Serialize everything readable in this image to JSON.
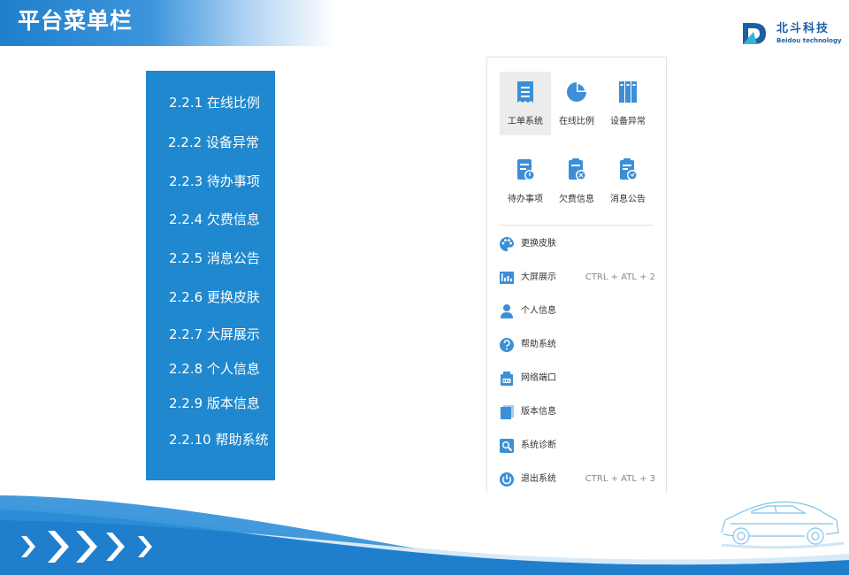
{
  "header": {
    "title": "平台菜单栏"
  },
  "logo": {
    "name": "北斗科技",
    "sub": "Beidou technology"
  },
  "toc": {
    "items": [
      "2.2.1 在线比例",
      "2.2.2 设备异常",
      "2.2.3 待办事项",
      "2.2.4 欠费信息",
      "2.2.5 消息公告",
      "2.2.6 更换皮肤",
      "2.2.7 大屏展示",
      "2.2.8 个人信息",
      "2.2.9 版本信息",
      "2.2.10 帮助系统"
    ]
  },
  "menu": {
    "grid": [
      {
        "label": "工单系统",
        "icon": "work-order-icon"
      },
      {
        "label": "在线比例",
        "icon": "pie-chart-icon"
      },
      {
        "label": "设备异常",
        "icon": "device-alert-icon"
      },
      {
        "label": "待办事项",
        "icon": "todo-icon"
      },
      {
        "label": "欠费信息",
        "icon": "arrears-icon"
      },
      {
        "label": "消息公告",
        "icon": "notice-icon"
      }
    ],
    "list": [
      {
        "label": "更换皮肤",
        "icon": "palette-icon",
        "shortcut": ""
      },
      {
        "label": "大屏展示",
        "icon": "monitor-icon",
        "shortcut": "CTRL + ATL + 2"
      },
      {
        "label": "个人信息",
        "icon": "user-icon",
        "shortcut": ""
      },
      {
        "label": "帮助系统",
        "icon": "help-icon",
        "shortcut": ""
      },
      {
        "label": "网络端口",
        "icon": "network-port-icon",
        "shortcut": ""
      },
      {
        "label": "版本信息",
        "icon": "version-icon",
        "shortcut": ""
      },
      {
        "label": "系统诊断",
        "icon": "diagnosis-icon",
        "shortcut": ""
      },
      {
        "label": "退出系统",
        "icon": "power-icon",
        "shortcut": "CTRL + ATL + 3"
      }
    ]
  },
  "colors": {
    "brand_blue": "#1f88cf",
    "icon_blue": "#3c8fd6",
    "logo_blue": "#1b5fa6"
  }
}
